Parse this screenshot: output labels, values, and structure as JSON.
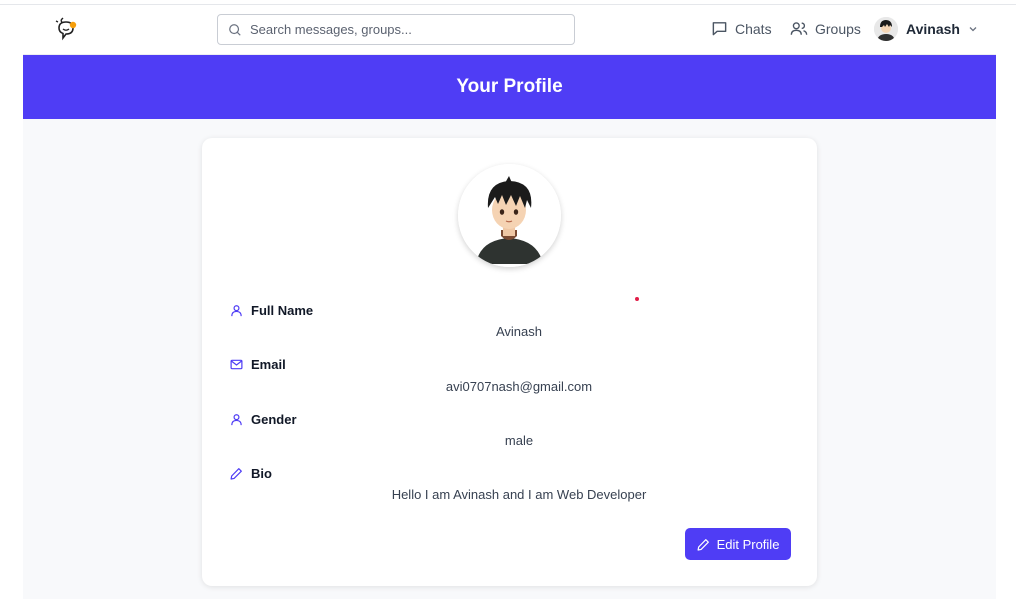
{
  "nav": {
    "search_placeholder": "Search messages, groups...",
    "chats_label": "Chats",
    "groups_label": "Groups",
    "user_name": "Avinash"
  },
  "banner": {
    "title": "Your Profile"
  },
  "profile": {
    "fields": [
      {
        "label": "Full Name",
        "value": "Avinash",
        "icon": "user-icon"
      },
      {
        "label": "Email",
        "value": "avi0707nash@gmail.com",
        "icon": "mail-icon"
      },
      {
        "label": "Gender",
        "value": "male",
        "icon": "user-icon"
      },
      {
        "label": "Bio",
        "value": "Hello I am Avinash and I am Web Developer",
        "icon": "pencil-icon"
      }
    ],
    "edit_label": "Edit Profile"
  },
  "colors": {
    "accent": "#4f3df5",
    "logo_dot": "#f59e0b",
    "marker_dot": "#e11d48"
  }
}
